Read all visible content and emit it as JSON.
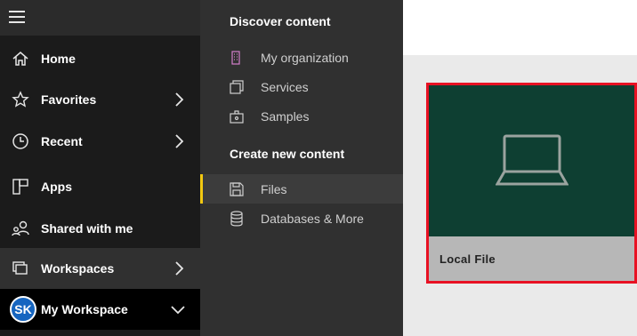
{
  "nav": {
    "items": [
      {
        "label": "Home",
        "icon": "home-icon"
      },
      {
        "label": "Favorites",
        "icon": "star-icon"
      },
      {
        "label": "Recent",
        "icon": "clock-icon"
      },
      {
        "label": "Apps",
        "icon": "apps-icon"
      },
      {
        "label": "Shared with me",
        "icon": "shared-users-icon"
      },
      {
        "label": "Workspaces",
        "icon": "workspaces-icon"
      },
      {
        "label": "My Workspace",
        "icon": "avatar"
      }
    ],
    "avatar_initials": "SK"
  },
  "panel": {
    "discover_heading": "Discover content",
    "discover_items": [
      {
        "label": "My organization",
        "icon": "building-icon"
      },
      {
        "label": "Services",
        "icon": "services-icon"
      },
      {
        "label": "Samples",
        "icon": "samples-icon"
      }
    ],
    "create_heading": "Create new content",
    "create_items": [
      {
        "label": "Files",
        "icon": "save-icon"
      },
      {
        "label": "Databases & More",
        "icon": "database-icon"
      }
    ]
  },
  "main": {
    "card_label": "Local File",
    "card_icon": "laptop-icon",
    "card_color": "#0e3f32",
    "highlight_color": "#e81123"
  }
}
